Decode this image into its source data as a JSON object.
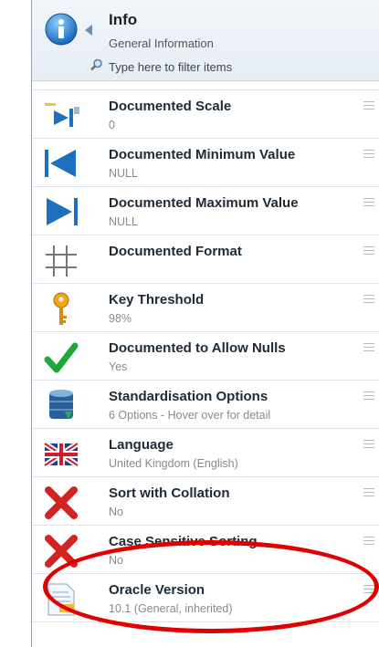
{
  "header": {
    "title": "Info",
    "subtitle": "General Information",
    "filter_placeholder": "Type here to filter items"
  },
  "items": [
    {
      "title": "Documented Scale",
      "value": "0",
      "icon": "scale-icon"
    },
    {
      "title": "Documented Minimum Value",
      "value": "NULL",
      "icon": "minimum-icon"
    },
    {
      "title": "Documented Maximum Value",
      "value": "NULL",
      "icon": "maximum-icon"
    },
    {
      "title": "Documented Format",
      "value": "",
      "icon": "format-grid-icon"
    },
    {
      "title": "Key Threshold",
      "value": "98%",
      "icon": "key-icon"
    },
    {
      "title": "Documented to Allow Nulls",
      "value": "Yes",
      "icon": "check-icon"
    },
    {
      "title": "Standardisation Options",
      "value": "6 Options - Hover over for detail",
      "icon": "database-icon"
    },
    {
      "title": "Language",
      "value": "United Kingdom (English)",
      "icon": "uk-flag-icon"
    },
    {
      "title": "Sort with Collation",
      "value": "No",
      "icon": "red-x-icon"
    },
    {
      "title": "Case Sensitive Sorting",
      "value": "No",
      "icon": "red-x-icon"
    },
    {
      "title": "Oracle Version",
      "value": "10.1 (General, inherited)",
      "icon": "document-icon"
    }
  ],
  "colors": {
    "accent": "#1f8ad6",
    "highlight_oval": "#e00000"
  }
}
